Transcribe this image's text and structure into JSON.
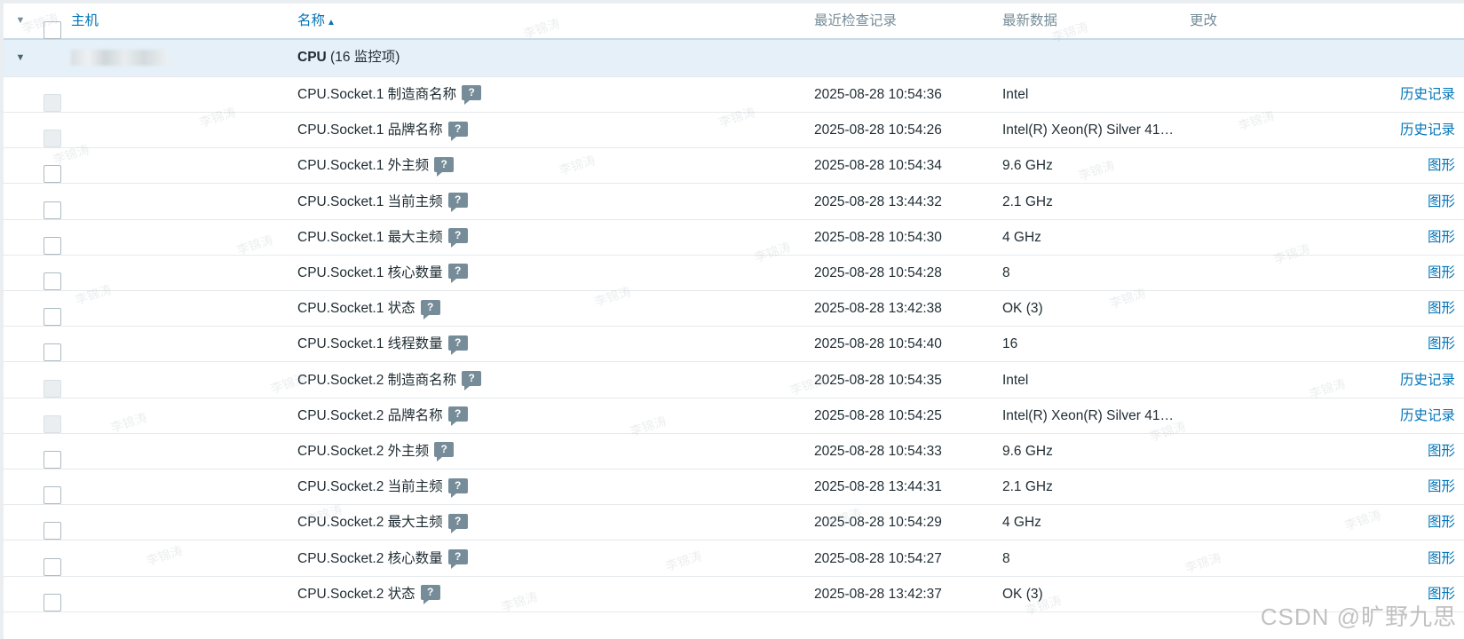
{
  "header": {
    "host_label": "主机",
    "name_label": "名称",
    "sort_indicator": "▲",
    "last_check_label": "最近检查记录",
    "latest_data_label": "最新数据",
    "change_label": "更改"
  },
  "group": {
    "title": "CPU",
    "count_text": "(16 监控项)",
    "toggle": "▼"
  },
  "help_glyph": "?",
  "rows": [
    {
      "name": "CPU.Socket.1 制造商名称",
      "time": "2025-08-28 10:54:36",
      "value": "Intel",
      "action": "历史记录",
      "checkbox_disabled": true
    },
    {
      "name": "CPU.Socket.1 品牌名称",
      "time": "2025-08-28 10:54:26",
      "value": "Intel(R) Xeon(R) Silver 41…",
      "action": "历史记录",
      "checkbox_disabled": true
    },
    {
      "name": "CPU.Socket.1 外主频",
      "time": "2025-08-28 10:54:34",
      "value": "9.6 GHz",
      "action": "图形",
      "checkbox_disabled": false
    },
    {
      "name": "CPU.Socket.1 当前主频",
      "time": "2025-08-28 13:44:32",
      "value": "2.1 GHz",
      "action": "图形",
      "checkbox_disabled": false
    },
    {
      "name": "CPU.Socket.1 最大主频",
      "time": "2025-08-28 10:54:30",
      "value": "4 GHz",
      "action": "图形",
      "checkbox_disabled": false
    },
    {
      "name": "CPU.Socket.1 核心数量",
      "time": "2025-08-28 10:54:28",
      "value": "8",
      "action": "图形",
      "checkbox_disabled": false
    },
    {
      "name": "CPU.Socket.1 状态",
      "time": "2025-08-28 13:42:38",
      "value": "OK (3)",
      "action": "图形",
      "checkbox_disabled": false
    },
    {
      "name": "CPU.Socket.1 线程数量",
      "time": "2025-08-28 10:54:40",
      "value": "16",
      "action": "图形",
      "checkbox_disabled": false
    },
    {
      "name": "CPU.Socket.2 制造商名称",
      "time": "2025-08-28 10:54:35",
      "value": "Intel",
      "action": "历史记录",
      "checkbox_disabled": true
    },
    {
      "name": "CPU.Socket.2 品牌名称",
      "time": "2025-08-28 10:54:25",
      "value": "Intel(R) Xeon(R) Silver 41…",
      "action": "历史记录",
      "checkbox_disabled": true
    },
    {
      "name": "CPU.Socket.2 外主频",
      "time": "2025-08-28 10:54:33",
      "value": "9.6 GHz",
      "action": "图形",
      "checkbox_disabled": false
    },
    {
      "name": "CPU.Socket.2 当前主频",
      "time": "2025-08-28 13:44:31",
      "value": "2.1 GHz",
      "action": "图形",
      "checkbox_disabled": false
    },
    {
      "name": "CPU.Socket.2 最大主频",
      "time": "2025-08-28 10:54:29",
      "value": "4 GHz",
      "action": "图形",
      "checkbox_disabled": false
    },
    {
      "name": "CPU.Socket.2 核心数量",
      "time": "2025-08-28 10:54:27",
      "value": "8",
      "action": "图形",
      "checkbox_disabled": false
    },
    {
      "name": "CPU.Socket.2 状态",
      "time": "2025-08-28 13:42:37",
      "value": "OK (3)",
      "action": "图形",
      "checkbox_disabled": false
    }
  ],
  "watermark_text": "李锦涛",
  "site_watermark": "CSDN @旷野九思",
  "colors": {
    "link": "#0275b8",
    "group_bg": "#e5f0f8",
    "header_text": "#768d99",
    "help_icon": "#768d99"
  }
}
